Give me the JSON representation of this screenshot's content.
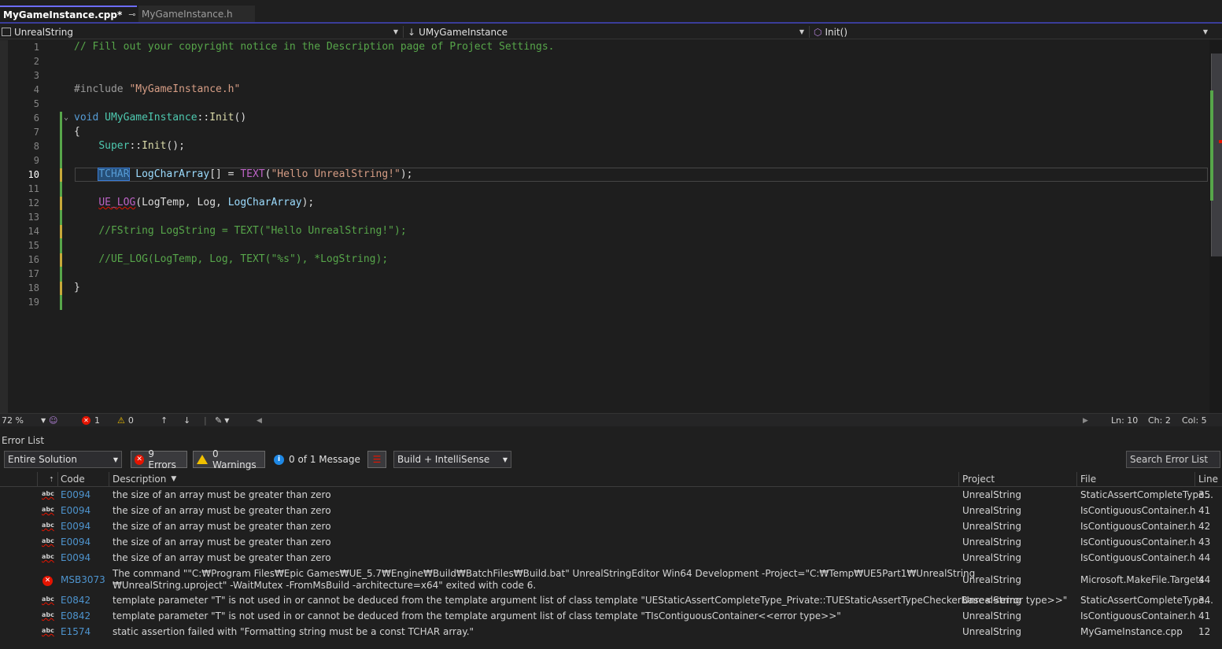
{
  "tabs": {
    "active": "MyGameInstance.cpp*",
    "inactive": "MyGameInstance.h"
  },
  "nav": {
    "project": "UnrealString",
    "class": "UMyGameInstance",
    "member": "Init()"
  },
  "editor": {
    "line_numbers": [
      "1",
      "2",
      "3",
      "4",
      "5",
      "6",
      "7",
      "8",
      "9",
      "10",
      "11",
      "12",
      "13",
      "14",
      "15",
      "16",
      "17",
      "18",
      "19"
    ],
    "current_line": "10"
  },
  "status": {
    "zoom": "72 %",
    "errors": "1",
    "warnings": "0",
    "ln": "Ln: 10",
    "ch": "Ch: 2",
    "col": "Col: 5"
  },
  "error_list": {
    "title": "Error List",
    "scope": "Entire Solution",
    "errors_btn": "9 Errors",
    "warnings_btn": "0 Warnings",
    "messages_btn": "0 of 1 Message",
    "build_filter": "Build + IntelliSense",
    "search_placeholder": "Search Error List",
    "columns": [
      "Code",
      "Description",
      "Project",
      "File",
      "Line"
    ],
    "rows": [
      {
        "code": "E0094",
        "desc": "the size of an array must be greater than zero",
        "project": "UnrealString",
        "file": "StaticAssertCompleteType...",
        "line": "35"
      },
      {
        "code": "E0094",
        "desc": "the size of an array must be greater than zero",
        "project": "UnrealString",
        "file": "IsContiguousContainer.h",
        "line": "41"
      },
      {
        "code": "E0094",
        "desc": "the size of an array must be greater than zero",
        "project": "UnrealString",
        "file": "IsContiguousContainer.h",
        "line": "42"
      },
      {
        "code": "E0094",
        "desc": "the size of an array must be greater than zero",
        "project": "UnrealString",
        "file": "IsContiguousContainer.h",
        "line": "43"
      },
      {
        "code": "E0094",
        "desc": "the size of an array must be greater than zero",
        "project": "UnrealString",
        "file": "IsContiguousContainer.h",
        "line": "44"
      },
      {
        "code": "MSB3073",
        "desc": "The command \"\"C:₩Program Files₩Epic Games₩UE_5.7₩Engine₩Build₩BatchFiles₩Build.bat\" UnrealStringEditor Win64 Development -Project=\"C:₩Temp₩UE5Part1₩UnrealString",
        "desc2": "₩UnrealString.uproject\" -WaitMutex -FromMsBuild -architecture=x64\" exited with code 6.",
        "project": "UnrealString",
        "file": "Microsoft.MakeFile.Targets",
        "line": "44"
      },
      {
        "code": "E0842",
        "desc": "template parameter \"T\" is not used in or cannot be deduced from the template argument list of class template \"UEStaticAssertCompleteType_Private::TUEStaticAssertTypeCheckerBase<<error type>>\"",
        "project": "UnrealString",
        "file": "StaticAssertCompleteType...",
        "line": "34"
      },
      {
        "code": "E0842",
        "desc": "template parameter \"T\" is not used in or cannot be deduced from the template argument list of class template \"TIsContiguousContainer<<error type>>\"",
        "project": "UnrealString",
        "file": "IsContiguousContainer.h",
        "line": "41"
      },
      {
        "code": "E1574",
        "desc": "static assertion failed with \"Formatting string must be a const TCHAR array.\"",
        "project": "UnrealString",
        "file": "MyGameInstance.cpp",
        "line": "12"
      }
    ]
  },
  "colors": {
    "accent": "#3a3d9a",
    "error": "#e51400",
    "warning": "#f0c000",
    "gutter_changed": "#57a64a"
  }
}
